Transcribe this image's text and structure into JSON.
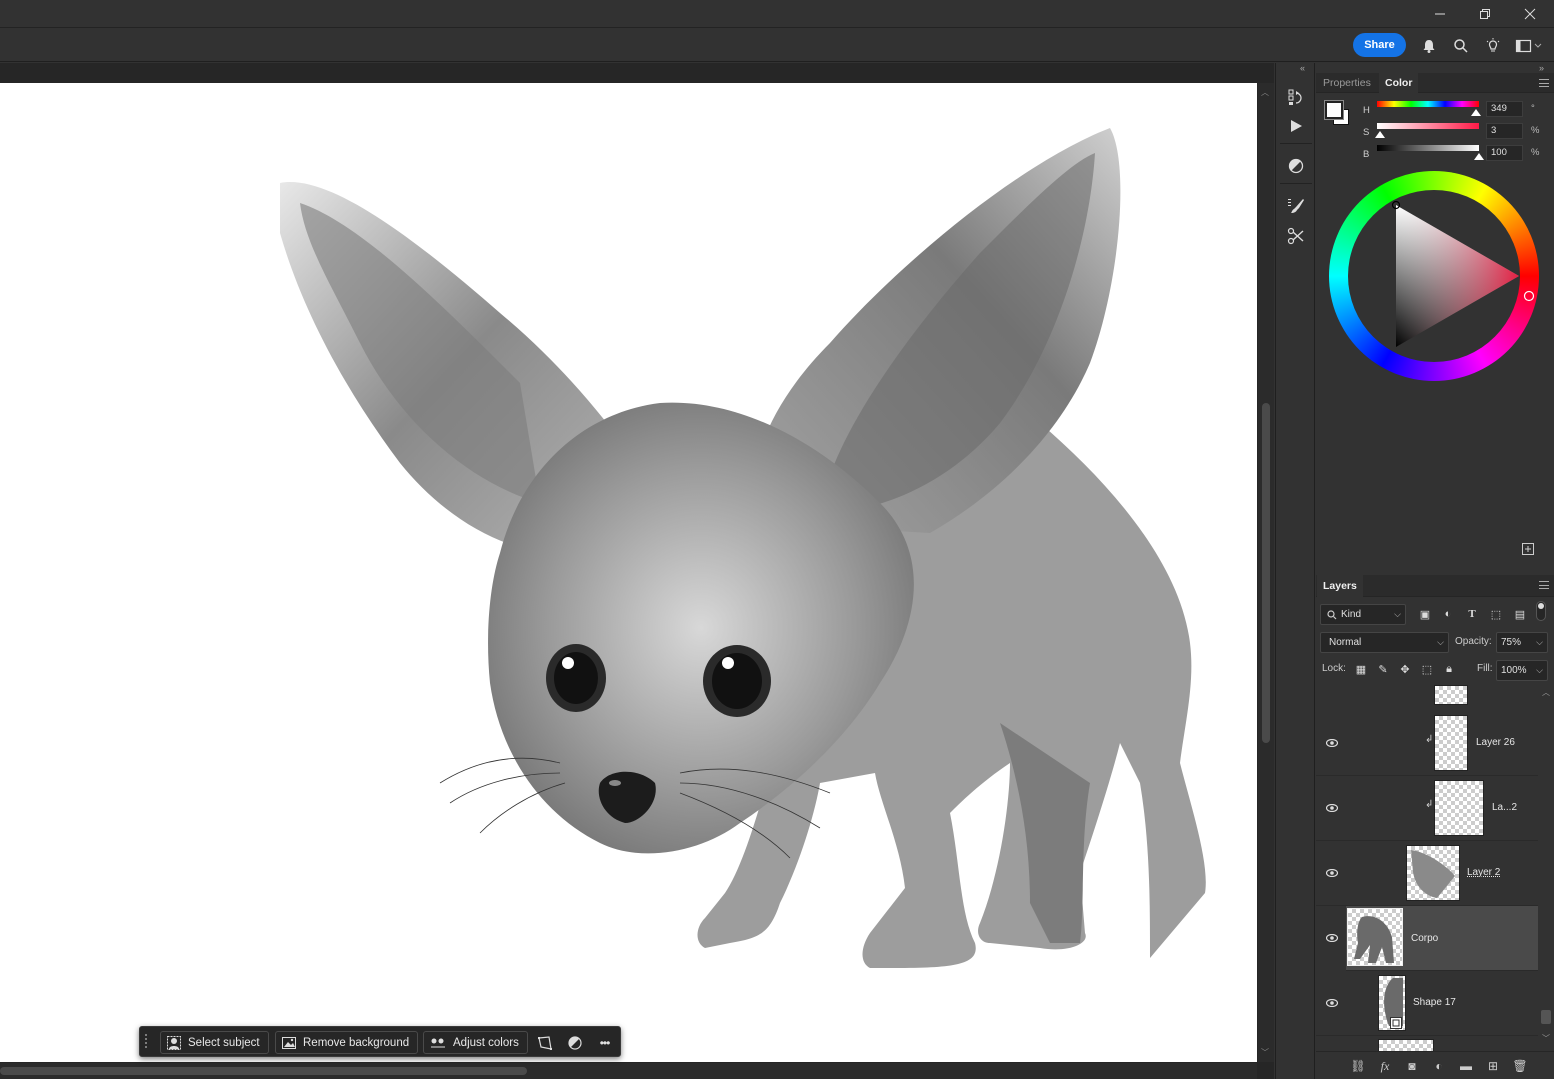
{
  "header": {
    "share_label": "Share"
  },
  "document": {
    "layers_visible": [
      "Corpo",
      "Layer 2",
      "Layer 26",
      "Shape 17"
    ]
  },
  "taskbar": {
    "select_subject": "Select subject",
    "remove_background": "Remove background",
    "adjust_colors": "Adjust colors",
    "more": "•••"
  },
  "color_panel": {
    "tabs": [
      "Properties",
      "Color"
    ],
    "active_tab": "Color",
    "h_label": "H",
    "s_label": "S",
    "b_label": "B",
    "h_value": "349",
    "s_value": "3",
    "b_value": "100",
    "h_unit": "°",
    "s_unit": "%",
    "b_unit": "%",
    "h_fraction": 0.97,
    "s_fraction": 0.03,
    "b_fraction": 1.0
  },
  "layers_panel": {
    "title": "Layers",
    "filter_kind": "Kind",
    "blend_mode": "Normal",
    "opacity_label": "Opacity:",
    "opacity_value": "75%",
    "lock_label": "Lock:",
    "fill_label": "Fill:",
    "fill_value": "100%",
    "layers": [
      {
        "name": "Layer 26",
        "clipped": true,
        "visible": true,
        "selected": false
      },
      {
        "name": "La...2",
        "clipped": true,
        "visible": true,
        "selected": false
      },
      {
        "name": "Layer 2",
        "clipped": false,
        "visible": true,
        "selected": false
      },
      {
        "name": "Corpo",
        "clipped": false,
        "visible": true,
        "selected": true
      },
      {
        "name": "Shape 17",
        "clipped": false,
        "visible": true,
        "selected": false
      }
    ]
  }
}
